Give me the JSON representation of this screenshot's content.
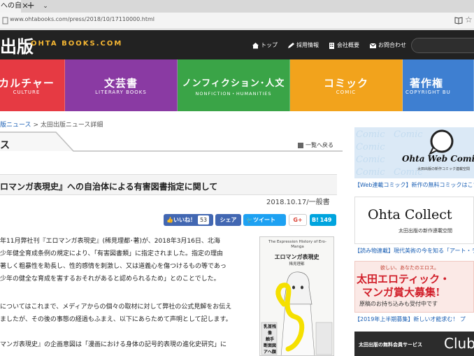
{
  "browser": {
    "tab_title": "への自",
    "url": "www.ohtabooks.com/press/2018/10/17110000.html"
  },
  "header": {
    "logo_kanji": "出版",
    "logo_en": "OHTA BOOKS.COM",
    "nav": [
      {
        "label": "トップ",
        "icon": "home-icon"
      },
      {
        "label": "採用情報",
        "icon": "pen-icon"
      },
      {
        "label": "会社概要",
        "icon": "building-icon"
      },
      {
        "label": "お問合わせ",
        "icon": "mail-icon"
      }
    ],
    "search_placeholder": ""
  },
  "categories": [
    {
      "jp": "カルチャー",
      "en": "CULTURE",
      "color": "#e63a43"
    },
    {
      "jp": "文芸書",
      "en": "LITERARY BOOKS",
      "color": "#8a3aa3"
    },
    {
      "jp": "ノンフィクション･人文",
      "en": "NONFICTION・HUMANITIES",
      "color": "#3aa447"
    },
    {
      "jp": "コミック",
      "en": "COMIC",
      "color": "#f2a31c"
    },
    {
      "jp": "著作権",
      "en": "COPYRIGHT BU",
      "color": "#3e7fd1"
    }
  ],
  "breadcrumb": {
    "item1": "版ニュース",
    "sep": ">",
    "item2": "太田出版ニュース詳細"
  },
  "section_title": "ス",
  "back_link": "一覧へ戻る",
  "article": {
    "title": "ロマンガ表現史』への自治体による有害図書指定に関して",
    "meta": "2018.10.17/一般書"
  },
  "share": {
    "like_label": "いいね！",
    "like_count": "53",
    "share_label": "シェア",
    "tweet_label": "ツイート",
    "gplus_label": "G+",
    "hatena_label": "B!",
    "hatena_count": "149"
  },
  "body": [
    "年11月弊社刊『エロマンガ表現史』(稀見理都･著)が、2018年3月16日、北海",
    "少年健全育成条例の規定により、「有害図書類」に指定されました。指定の理由",
    "著しく粗暴性を助長し、性的感情を刺激し、又は道義心を傷つけるもの等であっ",
    "少年の健全な育成を害するおそれがあると認められるため」とのことでした。",
    "",
    "についてはこれまで、メディアからの個々の取材に対して弊社の公式見解をお伝え",
    "ましたが、その後の事態の経過もふまえ、以下にあらためて声明として記します。",
    "",
    "マンガ表現史』の企画意図は「漫画における身体の記号的表現の進化史研究」に"
  ],
  "book": {
    "title_en": "The Expression History of Ero-Manga",
    "title_jp": "エロマンガ表現史",
    "author": "稀見理都",
    "band_lines": [
      "乳首残像",
      "触手",
      "断面図",
      "アヘ顔"
    ]
  },
  "sidebar": {
    "banner1_logo": "Ohta Web Comic",
    "banner1_sub": "太田出版の新作コミック連載空間",
    "link1": "【Web連載コミック】新作の無料コミックはこち",
    "banner2_logo": "Ohta Collect",
    "banner2_sub": "太田出版の新作連載空間",
    "link2": "【読み物連載】現代美術の今を知る「アート・ラ",
    "banner3_line1": "欲しい、あなたのエロス。",
    "banner3_line2": "太田エロティック・",
    "banner3_line3": "マンガ賞大募集!",
    "banner3_line4": "原稿のお持ち込みも受付中です",
    "link3": "【2019年上半期募集】新しい才能求む！ プ",
    "banner4_text": "太田出版の無料会員サービス",
    "banner4_logo": "Club"
  }
}
